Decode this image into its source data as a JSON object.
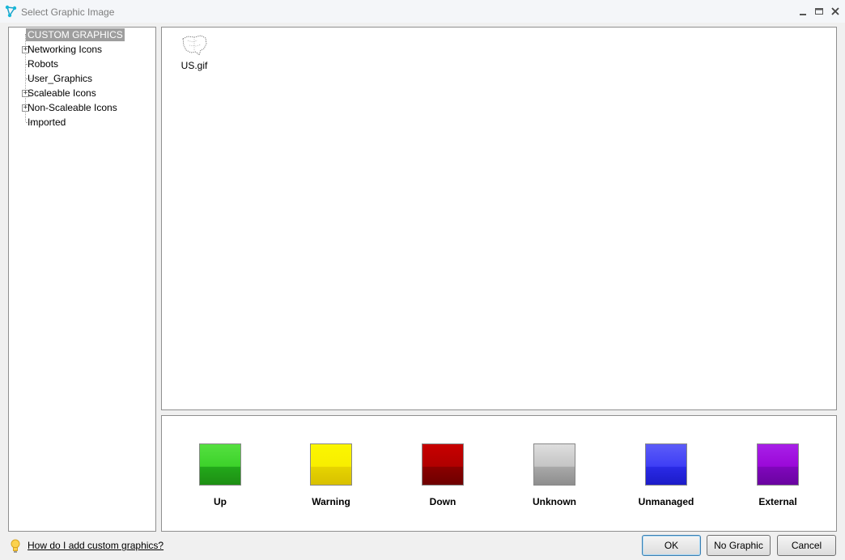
{
  "window": {
    "title": "Select Graphic Image",
    "app_icon": "network-graph-icon",
    "controls": {
      "minimize": "minimize-icon",
      "maximize": "maximize-icon",
      "close": "close-icon"
    }
  },
  "tree": {
    "items": [
      {
        "label": "CUSTOM GRAPHICS",
        "expandable": false,
        "selected": true
      },
      {
        "label": "Networking Icons",
        "expandable": true,
        "selected": false
      },
      {
        "label": "Robots",
        "expandable": false,
        "selected": false
      },
      {
        "label": "User_Graphics",
        "expandable": false,
        "selected": false
      },
      {
        "label": "Scaleable Icons",
        "expandable": true,
        "selected": false
      },
      {
        "label": "Non-Scaleable Icons",
        "expandable": true,
        "selected": false
      },
      {
        "label": "Imported",
        "expandable": false,
        "selected": false
      }
    ]
  },
  "images": {
    "files": [
      {
        "name": "US.gif",
        "icon": "us-map-thumbnail"
      }
    ]
  },
  "statuses": {
    "items": [
      {
        "label": "Up",
        "color": "#3cd22a"
      },
      {
        "label": "Warning",
        "color": "#f8ee00"
      },
      {
        "label": "Down",
        "color": "#b00000"
      },
      {
        "label": "Unknown",
        "color": "#c4c4c4"
      },
      {
        "label": "Unmanaged",
        "color": "#3e3ef5"
      },
      {
        "label": "External",
        "color": "#9a08d8"
      }
    ]
  },
  "footer": {
    "help_icon": "lightbulb-icon",
    "help_link": "How do I add custom graphics?",
    "ok_label": "OK",
    "no_graphic_label": "No Graphic",
    "cancel_label": "Cancel"
  }
}
